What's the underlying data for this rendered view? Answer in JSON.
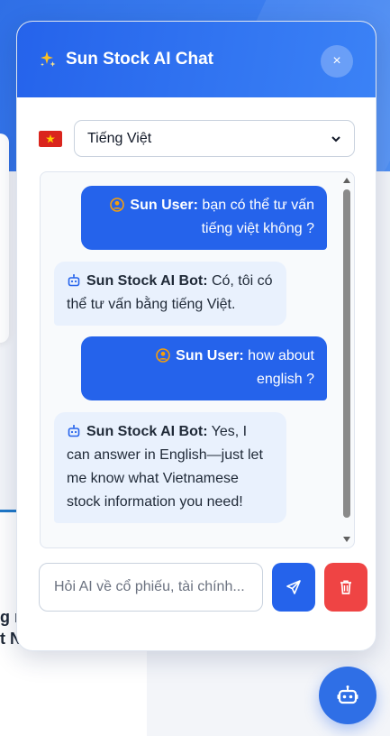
{
  "chat": {
    "title": "Sun Stock AI Chat",
    "close_label": "×",
    "language": {
      "selected": "Tiếng Việt"
    },
    "messages": [
      {
        "role": "user",
        "sender": "Sun User:",
        "text": " bạn có thể tư vấn tiếng việt không ?"
      },
      {
        "role": "bot",
        "sender": "Sun Stock AI Bot:",
        "text": " Có, tôi có thể tư vấn bằng tiếng Việt."
      },
      {
        "role": "user",
        "sender": "Sun User:",
        "text": " how about english ?"
      },
      {
        "role": "bot",
        "sender": "Sun Stock AI Bot:",
        "text": " Yes, I can answer in English—just let me know what Vietnamese stock information you need!"
      }
    ],
    "input": {
      "placeholder": "Hỏi AI về cổ phiếu, tài chính...",
      "value": ""
    }
  },
  "colors": {
    "primary": "#2563eb",
    "danger": "#ef4444",
    "user_icon": "#f59e0b",
    "bot_bubble": "#e9f1fd"
  },
  "icons": {
    "header": "sparkle-icon",
    "flag": "vietnam-flag-icon",
    "user": "user-circle-icon",
    "bot": "robot-icon",
    "send": "send-icon",
    "delete": "trash-icon",
    "fab": "robot-icon"
  }
}
